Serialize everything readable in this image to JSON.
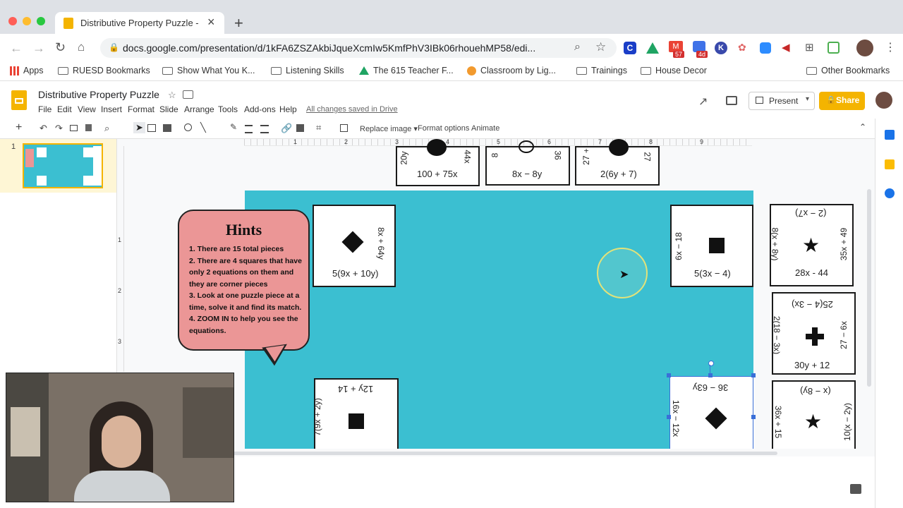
{
  "browser": {
    "tab_title": "Distributive Property Puzzle - G",
    "new_tab": "+",
    "close": "×",
    "url": "docs.google.com/presentation/d/1kFA6ZSZAkbiJqueXcmIw5KmfPhV3IBk06rhouehMP58/edi...",
    "ext_badges": [
      "57",
      "4d"
    ]
  },
  "bookmarks": {
    "apps": "Apps",
    "items": [
      "RUESD Bookmarks",
      "Show What You K...",
      "Listening Skills",
      "The 615 Teacher F...",
      "Classroom by Lig...",
      "Trainings",
      "House Decor"
    ],
    "other": "Other Bookmarks"
  },
  "doc": {
    "title": "Distributive Property Puzzle",
    "menus": [
      "File",
      "Edit",
      "View",
      "Insert",
      "Format",
      "Slide",
      "Arrange",
      "Tools",
      "Add-ons",
      "Help"
    ],
    "save_status": "All changes saved in Drive",
    "present": "Present",
    "share": "Share"
  },
  "toolbar": {
    "replace_image": "Replace image",
    "format_options": "Format options",
    "animate": "Animate"
  },
  "ruler": [
    "1",
    "2",
    "3",
    "4",
    "5",
    "6",
    "7",
    "8",
    "9"
  ],
  "vruler": [
    "1",
    "2",
    "3"
  ],
  "filmstrip": {
    "slide_number": "1"
  },
  "hints": {
    "heading": "Hints",
    "lines": [
      "1. There are 15 total pieces",
      "2. There are 4 squares that have only 2 equations on them and they are corner pieces",
      "3. Look at one puzzle piece at a time, solve it and find its match.",
      "4. ZOOM IN to help you see the equations."
    ]
  },
  "pieces": {
    "top1_bottom": "100 + 75x",
    "top1_left": "20y",
    "top1_right": "44x",
    "top2_bottom": "8x − 8y",
    "top2_left": "8",
    "top2_right": "36",
    "top3_bottom": "2(6y + 7)",
    "top3_left": "27 +",
    "top3_right": "27",
    "p1_bottom": "5(9x + 10y)",
    "p1_right": "8x + 64y",
    "p2_bottom": "5(3x − 4)",
    "p2_left": "6x − 18",
    "p3_top": "(2 − x7)",
    "p3_bottom": "28x - 44",
    "p3_left": "8(x + 8y)",
    "p3_right": "35x + 49",
    "p4_top": "25(4 − 3x)",
    "p4_bottom": "30y + 12",
    "p4_left": "2(18 − 3x)",
    "p4_right": "27 − 6x",
    "p5_top": "12y + 14",
    "p5_left": "7(9x + 2y)",
    "p6_top": "36 − 63y",
    "p6_left": "16x − 12x",
    "p7_top": "(x − 8y)",
    "p7_left": "36x + 15",
    "p7_right": "10(x − 2y)"
  }
}
